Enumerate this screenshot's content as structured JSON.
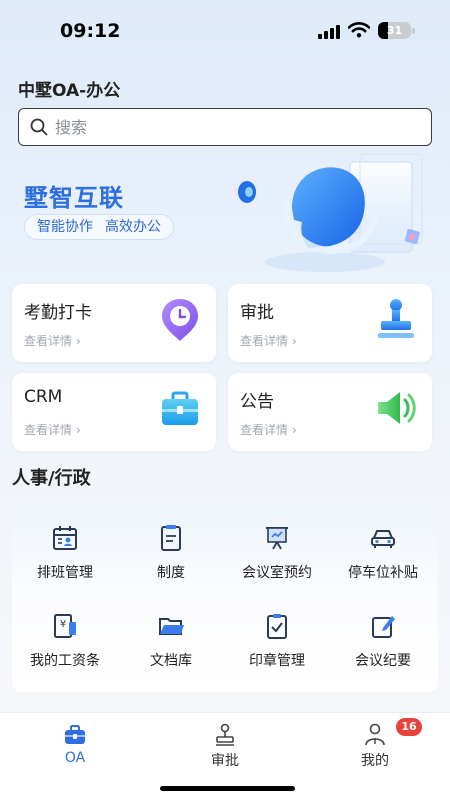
{
  "status_bar": {
    "time": "09:12",
    "battery": "31",
    "battery_level": 0.31
  },
  "header": {
    "title": "中墅OA-办公",
    "search_placeholder": "搜索"
  },
  "banner": {
    "title": "墅智互联",
    "tags": [
      "智能协作",
      "高效办公"
    ]
  },
  "quick_cards": [
    {
      "title": "考勤打卡",
      "link": "查看详情",
      "icon": "location-clock-icon"
    },
    {
      "title": "审批",
      "link": "查看详情",
      "icon": "stamp-icon"
    },
    {
      "title": "CRM",
      "link": "查看详情",
      "icon": "briefcase-icon"
    },
    {
      "title": "公告",
      "link": "查看详情",
      "icon": "speaker-icon"
    }
  ],
  "section": {
    "title": "人事/行政",
    "items": [
      {
        "label": "排班管理",
        "icon": "calendar-person-icon"
      },
      {
        "label": "制度",
        "icon": "document-icon"
      },
      {
        "label": "会议室预约",
        "icon": "presentation-icon"
      },
      {
        "label": "停车位补贴",
        "icon": "car-icon"
      },
      {
        "label": "我的工资条",
        "icon": "payslip-icon"
      },
      {
        "label": "文档库",
        "icon": "folder-icon"
      },
      {
        "label": "印章管理",
        "icon": "clipboard-check-icon"
      },
      {
        "label": "会议纪要",
        "icon": "edit-note-icon"
      }
    ]
  },
  "tabbar": {
    "tabs": [
      {
        "label": "OA",
        "icon": "briefcase-icon",
        "active": true
      },
      {
        "label": "审批",
        "icon": "stamp-icon",
        "active": false
      },
      {
        "label": "我的",
        "icon": "user-icon",
        "active": false
      }
    ],
    "badge": "16"
  },
  "colors": {
    "accent": "#2d6fe0",
    "tab_active": "#2e6ee0",
    "badge": "#e8433b"
  }
}
